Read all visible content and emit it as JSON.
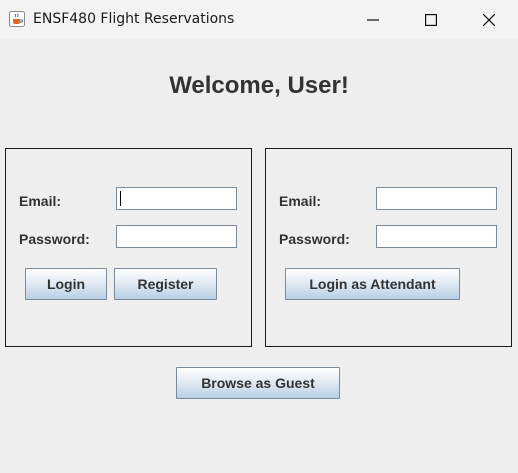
{
  "window": {
    "title": "ENSF480 Flight Reservations",
    "icon": "java-cup-icon",
    "controls": [
      "minimize-icon",
      "maximize-icon",
      "close-icon"
    ]
  },
  "main": {
    "welcome": "Welcome, User!"
  },
  "user_login": {
    "email_label": "Email:",
    "email_value": "",
    "password_label": "Password:",
    "password_value": "",
    "login_button": "Login",
    "register_button": "Register"
  },
  "attendant_login": {
    "email_label": "Email:",
    "email_value": "",
    "password_label": "Password:",
    "password_value": "",
    "login_button": "Login as Attendant"
  },
  "guest_button": "Browse as Guest",
  "colors": {
    "background": "#eeeeee",
    "text": "#333333",
    "button_gradient_bottom": "#b8cfe5"
  }
}
